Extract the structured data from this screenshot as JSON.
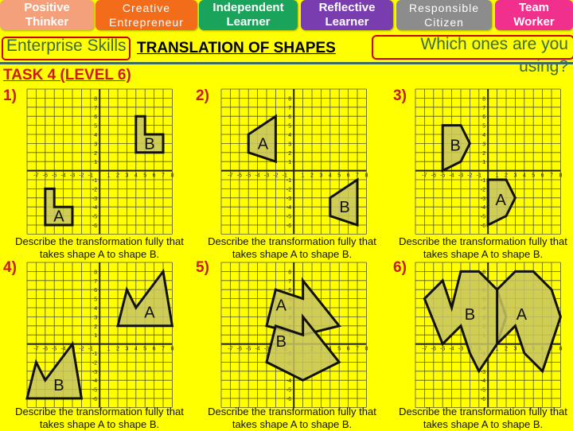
{
  "skills_tabs": [
    {
      "label_line1": "Positive",
      "label_line2": "Thinker",
      "color": "#f4a07a"
    },
    {
      "label_line1": "Creative",
      "label_line2": "Entrepreneur",
      "color": "#f26c1a"
    },
    {
      "label_line1": "Independent",
      "label_line2": "Learner",
      "color": "#1aa35a"
    },
    {
      "label_line1": "Reflective",
      "label_line2": "Learner",
      "color": "#7a3db0"
    },
    {
      "label_line1": "Responsible",
      "label_line2": "Citizen",
      "color": "#8c8c8c"
    },
    {
      "label_line1": "Team",
      "label_line2": "Worker",
      "color": "#f0308c"
    }
  ],
  "header": {
    "enterprise_label": "Enterprise Skills",
    "title": "TRANSLATION OF SHAPES",
    "prompt_line1": "Which ones are you",
    "prompt_line2": "using?"
  },
  "task_label": "TASK 4 (LEVEL 6)",
  "questions": [
    {
      "number": "1)",
      "description_line1": "Describe the transformation fully that",
      "description_line2": "takes shape A to shape B.",
      "shapes": [
        {
          "label": "A",
          "points": [
            [
              -6,
              -2
            ],
            [
              -5,
              -2
            ],
            [
              -5,
              -4
            ],
            [
              -3,
              -4
            ],
            [
              -3,
              -6
            ],
            [
              -6,
              -6
            ]
          ],
          "label_at": [
            -4.5,
            -5
          ]
        },
        {
          "label": "B",
          "points": [
            [
              4,
              6
            ],
            [
              5,
              6
            ],
            [
              5,
              4
            ],
            [
              7,
              4
            ],
            [
              7,
              2
            ],
            [
              4,
              2
            ]
          ],
          "label_at": [
            5.5,
            3
          ]
        }
      ]
    },
    {
      "number": "2)",
      "description_line1": "Describe the transformation fully that",
      "description_line2": "takes shape A to shape B.",
      "shapes": [
        {
          "label": "A",
          "points": [
            [
              -2,
              6
            ],
            [
              -5,
              4
            ],
            [
              -5,
              2
            ],
            [
              -2,
              1
            ]
          ],
          "label_at": [
            -3.4,
            3
          ]
        },
        {
          "label": "B",
          "points": [
            [
              7,
              -1
            ],
            [
              4,
              -3
            ],
            [
              4,
              -5
            ],
            [
              7,
              -6
            ]
          ],
          "label_at": [
            5.6,
            -4
          ]
        }
      ]
    },
    {
      "number": "3)",
      "description_line1": "Describe the transformation fully that",
      "description_line2": "takes shape A to shape B.",
      "shapes": [
        {
          "label": "A",
          "points": [
            [
              0,
              -1
            ],
            [
              2,
              -1
            ],
            [
              3,
              -3
            ],
            [
              2,
              -5
            ],
            [
              0,
              -6
            ]
          ],
          "label_at": [
            1.4,
            -3.2
          ]
        },
        {
          "label": "B",
          "points": [
            [
              -5,
              5
            ],
            [
              -3,
              5
            ],
            [
              -2,
              3
            ],
            [
              -3,
              1
            ],
            [
              -5,
              0
            ]
          ],
          "label_at": [
            -3.6,
            2.8
          ]
        }
      ]
    },
    {
      "number": "4)",
      "description_line1": "Describe the transformation fully that",
      "description_line2": "takes shape A to shape B.",
      "shapes": [
        {
          "label": "A",
          "points": [
            [
              2,
              2
            ],
            [
              3,
              6
            ],
            [
              4,
              4
            ],
            [
              7,
              8
            ],
            [
              8,
              2
            ]
          ],
          "label_at": [
            5.5,
            3.5
          ]
        },
        {
          "label": "B",
          "points": [
            [
              -8,
              -6
            ],
            [
              -7,
              -2
            ],
            [
              -6,
              -4
            ],
            [
              -3,
              0
            ],
            [
              -2,
              -6
            ]
          ],
          "label_at": [
            -4.5,
            -4.5
          ]
        }
      ]
    },
    {
      "number": "5)",
      "description_line1": "Describe the transformation fully that",
      "description_line2": "takes shape A to shape B.",
      "shapes": [
        {
          "label": "A",
          "points": [
            [
              -3,
              2
            ],
            [
              -2,
              6
            ],
            [
              1,
              5
            ],
            [
              1,
              7
            ],
            [
              5,
              2
            ],
            [
              1,
              1
            ]
          ],
          "label_at": [
            -1.4,
            4.3
          ]
        },
        {
          "label": "B",
          "points": [
            [
              -3,
              -2
            ],
            [
              -2,
              2
            ],
            [
              1,
              1
            ],
            [
              1,
              3
            ],
            [
              5,
              -2
            ],
            [
              1,
              -4
            ]
          ],
          "label_at": [
            -1.4,
            0.3
          ]
        }
      ]
    },
    {
      "number": "6)",
      "description_line1": "Describe the transformation fully that",
      "description_line2": "takes shape A to shape B.",
      "shapes": [
        {
          "label": "B",
          "points": [
            [
              -7,
              5
            ],
            [
              -5,
              7
            ],
            [
              -4,
              4
            ],
            [
              -3,
              8
            ],
            [
              -1,
              8
            ],
            [
              1,
              6
            ],
            [
              2,
              3
            ],
            [
              1,
              0
            ],
            [
              -1,
              -3
            ],
            [
              -2,
              -1
            ],
            [
              -3,
              2
            ],
            [
              -5,
              0
            ]
          ],
          "label_at": [
            -2,
            3.3
          ]
        },
        {
          "label": "A",
          "points": [
            [
              1,
              0
            ],
            [
              1,
              6
            ],
            [
              3,
              8
            ],
            [
              5,
              8
            ],
            [
              7,
              6
            ],
            [
              8,
              3
            ],
            [
              6,
              -3
            ],
            [
              4,
              -1
            ],
            [
              3,
              2
            ],
            [
              1,
              0
            ]
          ],
          "label_at": [
            3.7,
            3.3
          ]
        }
      ]
    }
  ],
  "axis": {
    "x_ticks": [
      "-7",
      "-6",
      "-5",
      "-4",
      "-3",
      "-2",
      "-1",
      "1",
      "2",
      "3",
      "4",
      "5",
      "6",
      "7",
      "8"
    ],
    "y_ticks_pos": [
      "1",
      "2",
      "3",
      "4",
      "5",
      "6",
      "7",
      "8"
    ],
    "y_ticks_neg": [
      "-1",
      "-2",
      "-3",
      "-4",
      "-5",
      "-6"
    ]
  },
  "colors": {
    "background": "#ffff00",
    "shape_fill": "#c8c464",
    "grid_line": "#555533",
    "question_number": "#cc1a1a"
  }
}
